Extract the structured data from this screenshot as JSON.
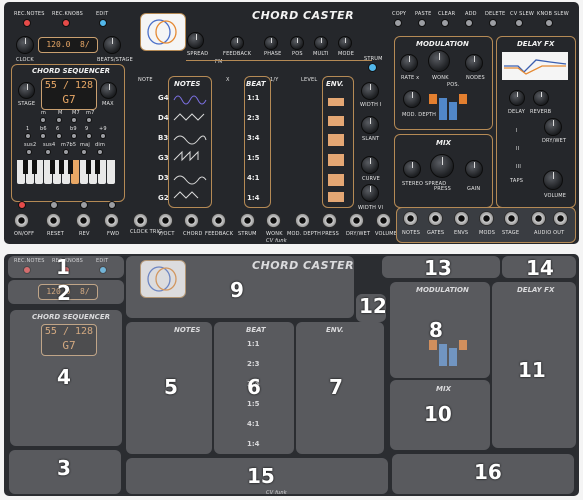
{
  "app": {
    "title": "CHORD CASTER",
    "footer": "CV funk"
  },
  "top_buttons": [
    "REC.NOTES",
    "REC.KNOBS",
    "EDIT"
  ],
  "tempo": {
    "bpm": "120.0",
    "sig": "8/"
  },
  "clock_labels": {
    "clock": "CLOCK",
    "beats": "BEATS/STAGE"
  },
  "top_right_buttons": [
    "COPY",
    "PASTE",
    "CLEAR",
    "ADD",
    "DELETE",
    "CV SLEW",
    "KNOB SLEW"
  ],
  "top_knob_labels": [
    "SPREAD",
    "FM",
    "FEEDBACK",
    "PHASE",
    "POS",
    "MULTI",
    "MODE"
  ],
  "strum": "STRUM",
  "seq": {
    "title": "CHORD SEQUENCER",
    "stage": "55 / 128",
    "chord": "G7",
    "stage_label": "STAGE",
    "max_label": "MAX",
    "row1": [
      "m",
      "M",
      "M7",
      "m7"
    ],
    "row2": [
      "1",
      "b6",
      "6",
      "b9",
      "9",
      "+9"
    ],
    "row3": [
      "sus2",
      "sus4",
      "m7b5",
      "maj",
      "dim"
    ]
  },
  "notes": {
    "header": "NOTES",
    "note_label": "NOTE",
    "items": [
      "G4",
      "D4",
      "B3",
      "G3",
      "D3",
      "G2"
    ]
  },
  "beat": {
    "header": "BEAT",
    "x_label": "X",
    "y_label": "1/Y",
    "items": [
      "1:1",
      "2:3",
      "3:4",
      "1:5",
      "4:1",
      "1:4"
    ]
  },
  "env": {
    "header": "ENV.",
    "level": "LEVEL",
    "labels": [
      "WIDTH I",
      "SLANT",
      "CURVE",
      "WIDTH VI"
    ]
  },
  "modulation": {
    "title": "MODULATION",
    "rate": "RATE x",
    "wonk": "WONK",
    "nodes": "NODES",
    "pos": "POS.",
    "depth": "MOD. DEPTH"
  },
  "mix": {
    "title": "MIX",
    "spread": "STEREO SPREAD",
    "press": "PRESS",
    "gain": "GAIN"
  },
  "delay": {
    "title": "DELAY FX",
    "delay": "DELAY",
    "reverb": "REVERB",
    "drywet": "DRY/WET",
    "taps": "TAPS",
    "tap_opts": [
      "I",
      "II",
      "III"
    ],
    "volume": "VOLUME"
  },
  "transport": [
    "ON/OFF",
    "RESET",
    "REV",
    "FWD"
  ],
  "jacks": [
    "CLOCK TRIG.",
    "V/OCT",
    "CHORD",
    "FEEDBACK",
    "STRUM",
    "WONK",
    "MOD. DEPTH",
    "PRESS",
    "DRY/WET",
    "VOLUME"
  ],
  "outputs": [
    "NOTES",
    "GATES",
    "ENVS",
    "MODS",
    "STAGE",
    "AUDIO OUT"
  ],
  "annotations": [
    "1",
    "2",
    "3",
    "4",
    "5",
    "6",
    "7",
    "8",
    "9",
    "10",
    "11",
    "12",
    "13",
    "14",
    "15",
    "16"
  ]
}
